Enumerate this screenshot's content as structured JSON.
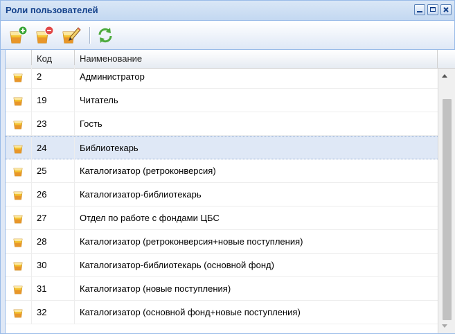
{
  "window": {
    "title": "Роли пользователей",
    "buttons": [
      "minimize",
      "maximize",
      "close"
    ]
  },
  "toolbar": {
    "buttons": [
      {
        "name": "add-role-button",
        "icon": "add-role-icon",
        "badge_color": "#3aa53a"
      },
      {
        "name": "delete-role-button",
        "icon": "delete-role-icon",
        "badge_color": "#e04848"
      },
      {
        "name": "edit-role-button",
        "icon": "edit-role-icon"
      },
      {
        "name": "refresh-button",
        "icon": "refresh-icon",
        "color": "#4caa3c"
      }
    ]
  },
  "grid": {
    "columns": [
      {
        "label": ""
      },
      {
        "label": "Код"
      },
      {
        "label": "Наименование"
      }
    ],
    "selected_index": 3,
    "rows": [
      {
        "code": "2",
        "name": "Администратор"
      },
      {
        "code": "19",
        "name": "Читатель"
      },
      {
        "code": "23",
        "name": "Гость"
      },
      {
        "code": "24",
        "name": "Библиотекарь"
      },
      {
        "code": "25",
        "name": "Каталогизатор (ретроконверсия)"
      },
      {
        "code": "26",
        "name": "Каталогизатор-библиотекарь"
      },
      {
        "code": "27",
        "name": "Отдел по работе с фондами ЦБС"
      },
      {
        "code": "28",
        "name": "Каталогизатор (ретроконверсия+новые поступления)"
      },
      {
        "code": "30",
        "name": "Каталогизатор-библиотекарь (основной фонд)"
      },
      {
        "code": "31",
        "name": "Каталогизатор (новые поступления)"
      },
      {
        "code": "32",
        "name": "Каталогизатор (основной фонд+новые поступления)"
      }
    ]
  },
  "colors": {
    "header_text": "#15428b",
    "border": "#99bbe8",
    "selected_row": "#dfe8f6",
    "icon_yellow": "#f4c430",
    "icon_orange": "#e8962a"
  }
}
